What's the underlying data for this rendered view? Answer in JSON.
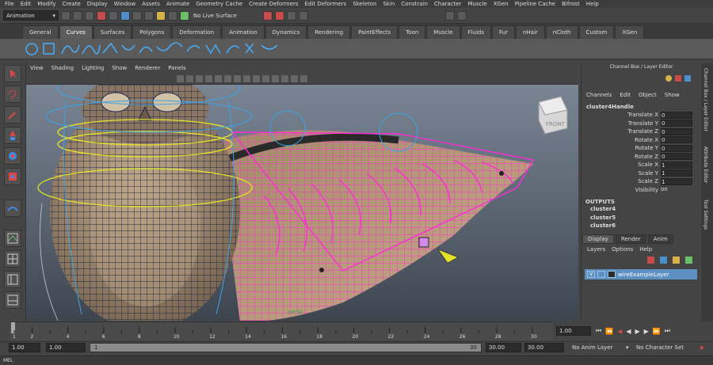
{
  "menubar": {
    "items": [
      "File",
      "Edit",
      "Modify",
      "Create",
      "Display",
      "Window",
      "Assets",
      "Animate",
      "Geometry Cache",
      "Create Deformers",
      "Edit Deformers",
      "Skeleton",
      "Skin",
      "Constrain",
      "Character",
      "Muscle",
      "XGen",
      "Pipeline Cache",
      "Bifrost",
      "Help"
    ]
  },
  "statusline": {
    "mode": "Animation",
    "live_surface": "No Live Surface"
  },
  "shelf": {
    "tabs": [
      "General",
      "Curves",
      "Surfaces",
      "Polygons",
      "Deformation",
      "Animation",
      "Dynamics",
      "Rendering",
      "PaintEffects",
      "Toon",
      "Muscle",
      "Fluids",
      "Fur",
      "nHair",
      "nCloth",
      "Custom",
      "XGen"
    ],
    "active_tab": "Curves"
  },
  "viewport": {
    "menu": [
      "View",
      "Shading",
      "Lighting",
      "Show",
      "Renderer",
      "Panels"
    ],
    "camera_label": "persp",
    "viewcube_label": "FRONT"
  },
  "channel_box": {
    "title": "Channel Box / Layer Editor",
    "menu": [
      "Channels",
      "Edit",
      "Object",
      "Show"
    ],
    "node": "cluster4Handle",
    "attributes": [
      {
        "name": "Translate X",
        "value": "0"
      },
      {
        "name": "Translate Y",
        "value": "0"
      },
      {
        "name": "Translate Z",
        "value": "0"
      },
      {
        "name": "Rotate X",
        "value": "0"
      },
      {
        "name": "Rotate Y",
        "value": "0"
      },
      {
        "name": "Rotate Z",
        "value": "0"
      },
      {
        "name": "Scale X",
        "value": "1"
      },
      {
        "name": "Scale Y",
        "value": "1"
      },
      {
        "name": "Scale Z",
        "value": "1"
      },
      {
        "name": "Visibility",
        "value": "on"
      }
    ],
    "outputs_label": "OUTPUTS",
    "outputs": [
      "cluster4",
      "cluster5",
      "cluster6"
    ]
  },
  "side_tabs": [
    "Channel Box / Layer Editor",
    "Attribute Editor",
    "Tool Settings"
  ],
  "layer_editor": {
    "tabs": [
      "Display",
      "Render",
      "Anim"
    ],
    "active_tab": "Display",
    "menu": [
      "Layers",
      "Options",
      "Help"
    ],
    "layer": {
      "visible": "V",
      "name": "wireExampleLayer"
    }
  },
  "time_slider": {
    "ticks": [
      "1",
      "2",
      "4",
      "6",
      "8",
      "10",
      "12",
      "14",
      "16",
      "18",
      "20",
      "22",
      "24",
      "26",
      "28",
      "30"
    ],
    "current_time": "1.00"
  },
  "range_slider": {
    "start": "1.00",
    "anim_start": "1.00",
    "range_label": "1",
    "range_end_label": "30",
    "anim_end": "30.00",
    "end": "30.00",
    "anim_layer": "No Anim Layer",
    "character_set": "No Character Set"
  },
  "command_line": {
    "label": "MEL"
  },
  "colors": {
    "layer_highlight": "#5d90c2",
    "wire_magenta": "#ff2bd6",
    "wire_yellow": "#e4e22a",
    "wire_blue": "#3da4e8",
    "persp_label": "#3fa34a"
  }
}
